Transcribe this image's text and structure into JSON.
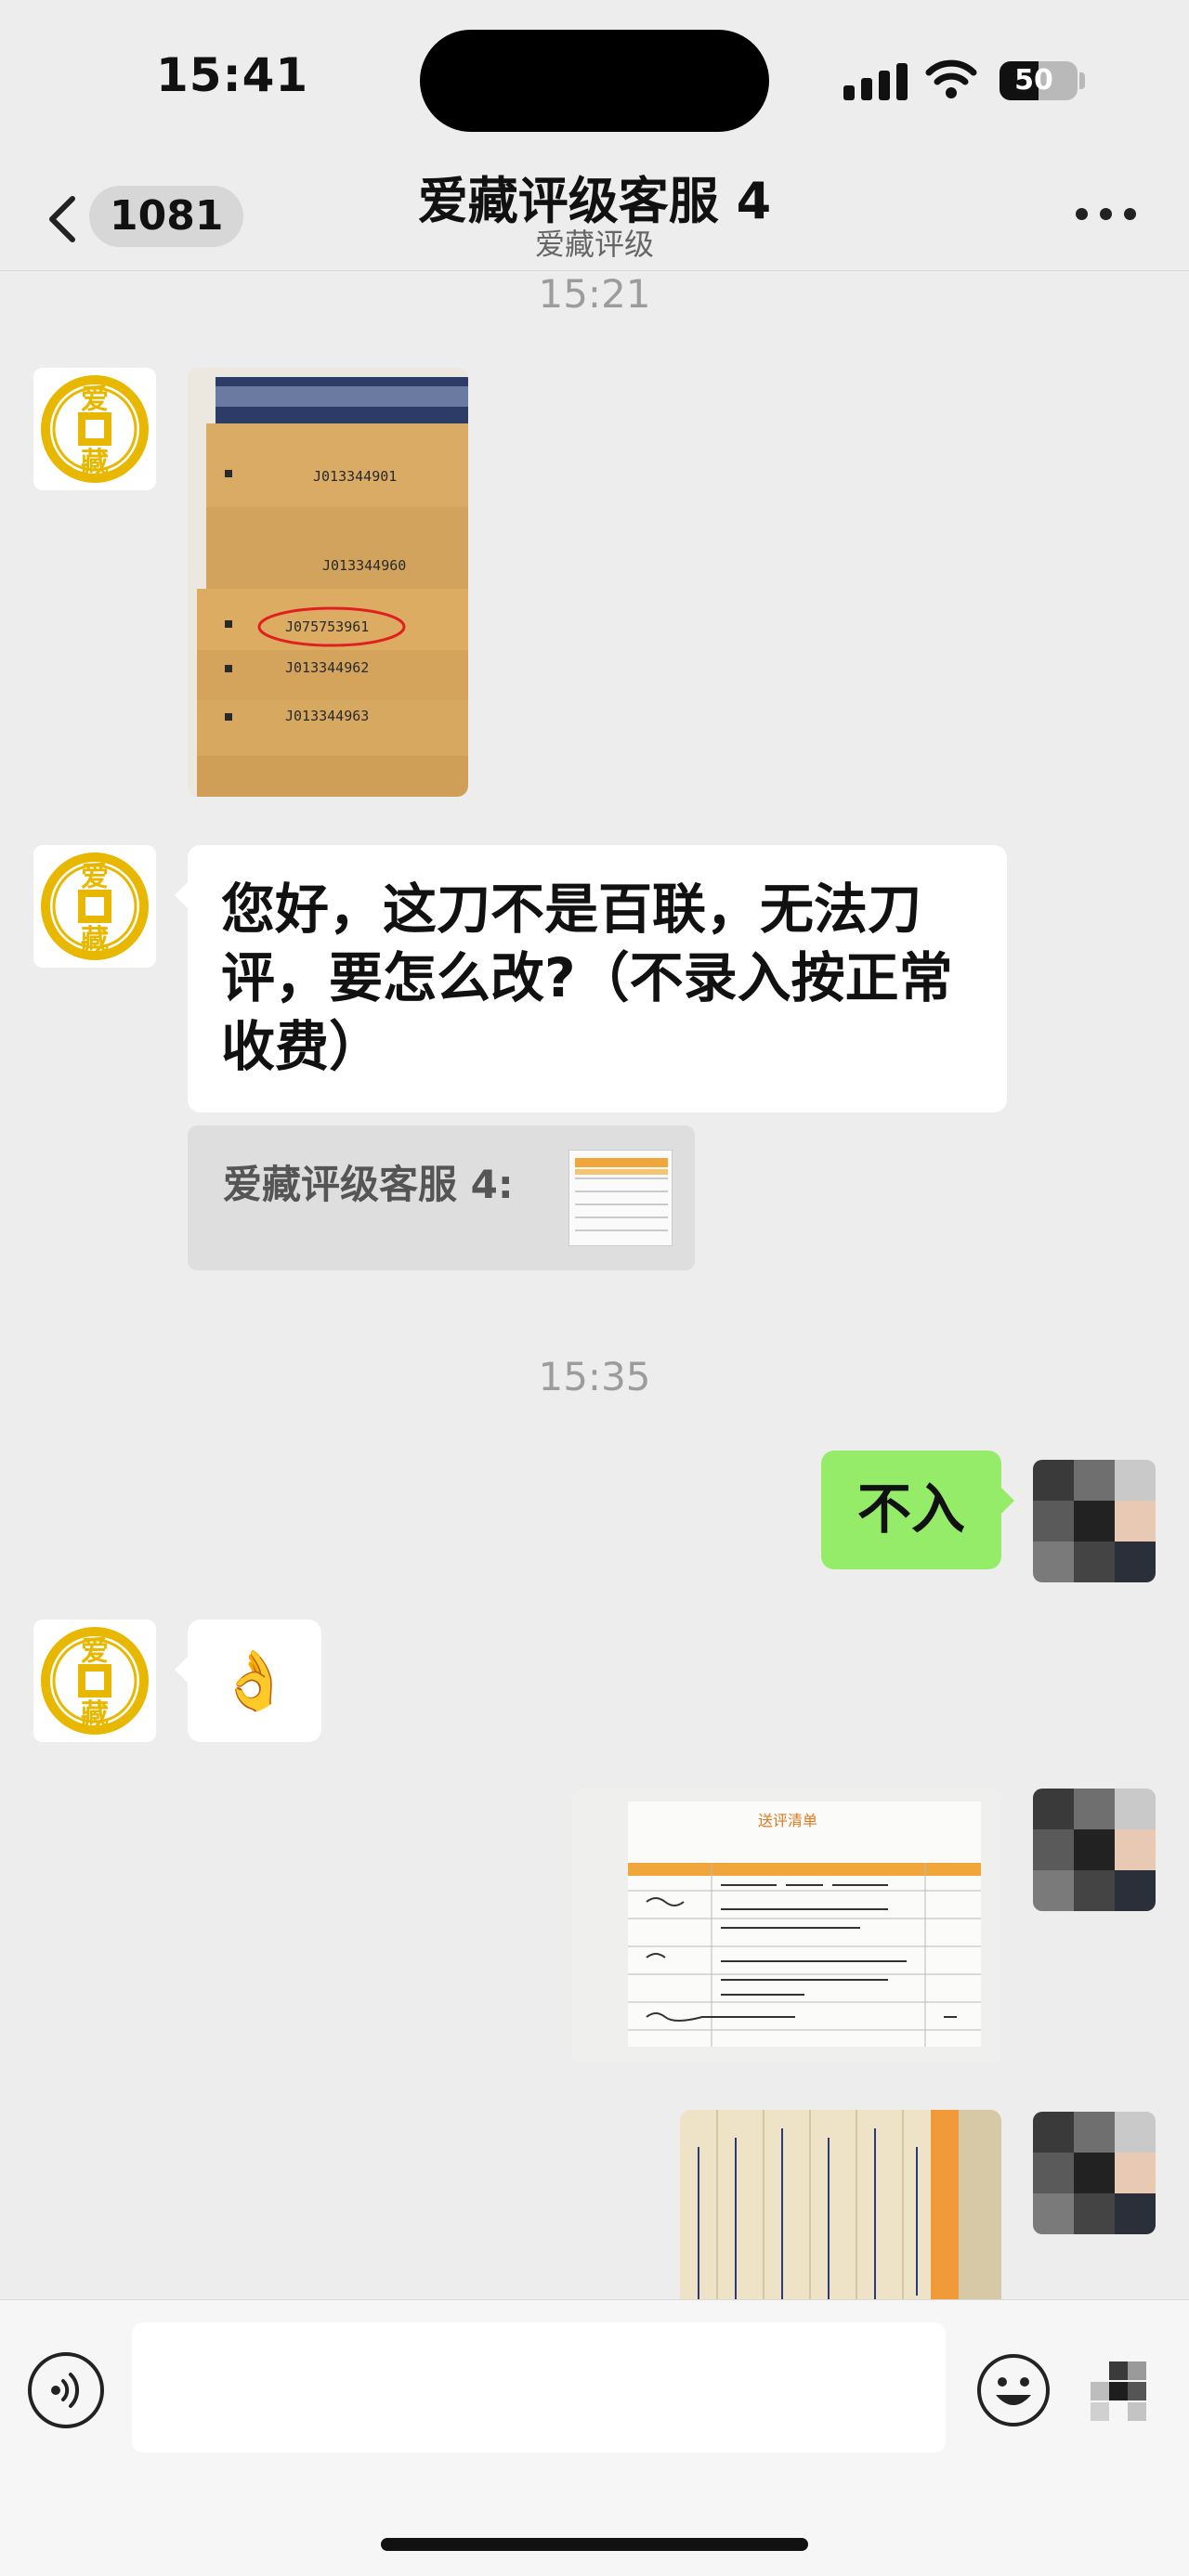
{
  "status_bar": {
    "time": "15:41",
    "battery_text": "50",
    "battery_level_percent": 50
  },
  "nav": {
    "unread_count": "1081",
    "title": "爱藏评级客服 4",
    "subtitle": "爱藏评级",
    "icons": {
      "back": "chevron-left-icon",
      "more": "more-dots-icon"
    }
  },
  "chat": {
    "timestamps": [
      "15:21",
      "15:35"
    ],
    "banknote_serials": [
      "J013344901",
      "J013344960",
      "J075753961",
      "J013344962",
      "J013344963"
    ],
    "message_text": "您好，这刀不是百联，无法刀评，要怎么改?（不录入按正常收费）",
    "message_lines": [
      "您好，这刀不是百联，无法刀",
      "评，要怎么改?（不录入按正常",
      "收费）"
    ],
    "quote_sender": "爱藏评级客服 4:",
    "user_reply": "不入",
    "emoji_reply": "👌",
    "form_header": "送评清单"
  },
  "brand_avatar": {
    "top_char": "爱",
    "bottom_char": "藏",
    "color": "#e8b800"
  },
  "input_bar": {
    "placeholder": "",
    "icons": {
      "voice": "voice-icon",
      "emoji": "emoji-icon",
      "plus": "plus-icon"
    }
  },
  "colors": {
    "background": "#ededed",
    "own_bubble": "#95ec69",
    "other_bubble": "#ffffff"
  }
}
